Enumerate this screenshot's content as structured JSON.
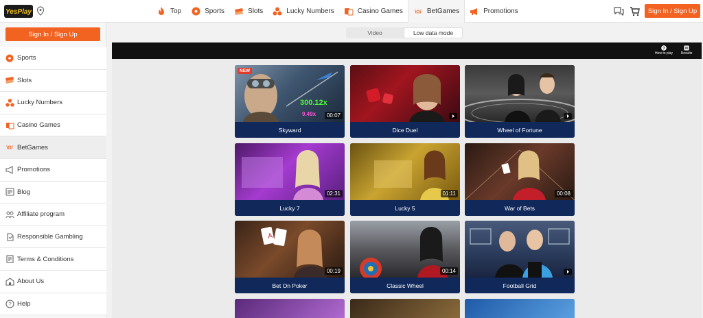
{
  "logo": {
    "text": "YesPlay"
  },
  "nav": {
    "items": [
      {
        "label": "Top",
        "icon": "flame-icon"
      },
      {
        "label": "Sports",
        "icon": "soccer-ball-icon"
      },
      {
        "label": "Slots",
        "icon": "slots-icon"
      },
      {
        "label": "Lucky Numbers",
        "icon": "lucky-numbers-icon"
      },
      {
        "label": "Casino Games",
        "icon": "casino-icon"
      },
      {
        "label": "BetGames",
        "icon": "betgames-icon"
      },
      {
        "label": "Promotions",
        "icon": "megaphone-icon"
      }
    ],
    "active": "BetGames"
  },
  "header": {
    "signin_label": "Sign In / Sign Up"
  },
  "sidebar": {
    "signin_label": "Sign In / Sign Up",
    "items": [
      {
        "label": "Sports",
        "icon": "soccer-ball-icon"
      },
      {
        "label": "Slots",
        "icon": "slots-icon"
      },
      {
        "label": "Lucky Numbers",
        "icon": "lucky-numbers-icon"
      },
      {
        "label": "Casino Games",
        "icon": "casino-icon"
      },
      {
        "label": "BetGames",
        "icon": "betgames-icon"
      },
      {
        "label": "Promotions",
        "icon": "megaphone-icon"
      },
      {
        "label": "Blog",
        "icon": "blog-icon"
      },
      {
        "label": "Affiliate program",
        "icon": "affiliate-icon"
      },
      {
        "label": "Responsible Gambling",
        "icon": "responsible-gambling-icon"
      },
      {
        "label": "Terms & Conditions",
        "icon": "terms-icon"
      },
      {
        "label": "About Us",
        "icon": "about-icon"
      },
      {
        "label": "Help",
        "icon": "help-icon"
      }
    ]
  },
  "mode_toggle": {
    "options": [
      "Video",
      "Low data mode"
    ],
    "selected": "Low data mode"
  },
  "game_header": {
    "how_to_play": "How to play",
    "results": "Results"
  },
  "games": [
    {
      "name": "Skyward",
      "duration": "00:07",
      "badge": "NEW",
      "multiplier": "300.12x",
      "multiplier2": "9.49x"
    },
    {
      "name": "Dice Duel"
    },
    {
      "name": "Wheel of Fortune"
    },
    {
      "name": "Lucky 7",
      "duration": "02:31"
    },
    {
      "name": "Lucky 5",
      "duration": "01:11"
    },
    {
      "name": "War of Bets",
      "duration": "00:08"
    },
    {
      "name": "Bet On Poker",
      "duration": "00:19"
    },
    {
      "name": "Classic Wheel",
      "duration": "00:14"
    },
    {
      "name": "Football Grid"
    }
  ],
  "colors": {
    "accent": "#f26322",
    "card_footer": "#10285a",
    "header_bar": "#111111"
  }
}
